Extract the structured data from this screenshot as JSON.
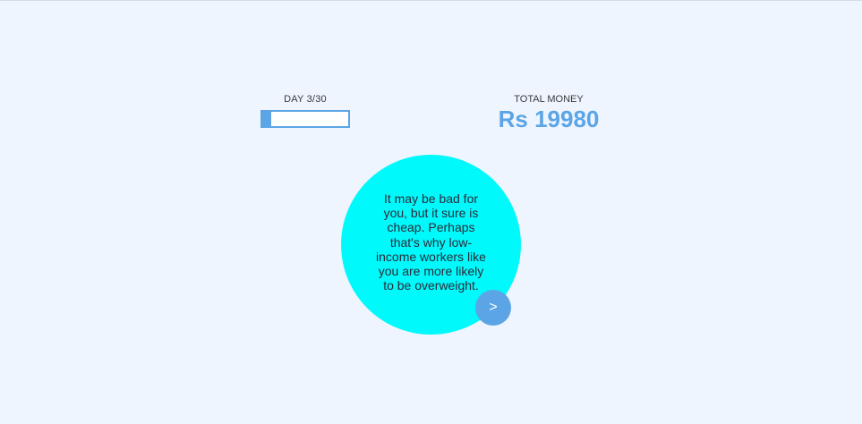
{
  "day": {
    "label": "DAY 3/30",
    "progress_fraction": 0.1
  },
  "money": {
    "label": "TOTAL MONEY",
    "value": "Rs 19980"
  },
  "message": {
    "text": "It may be bad for you, but it sure is cheap. Perhaps that's why low-income workers like you are more likely to be overweight."
  },
  "next_button": {
    "label": ">"
  },
  "colors": {
    "background": "#eef5ff",
    "accent": "#5ba5e6",
    "bubble": "#00f9fa",
    "text": "#2b2b3a"
  }
}
